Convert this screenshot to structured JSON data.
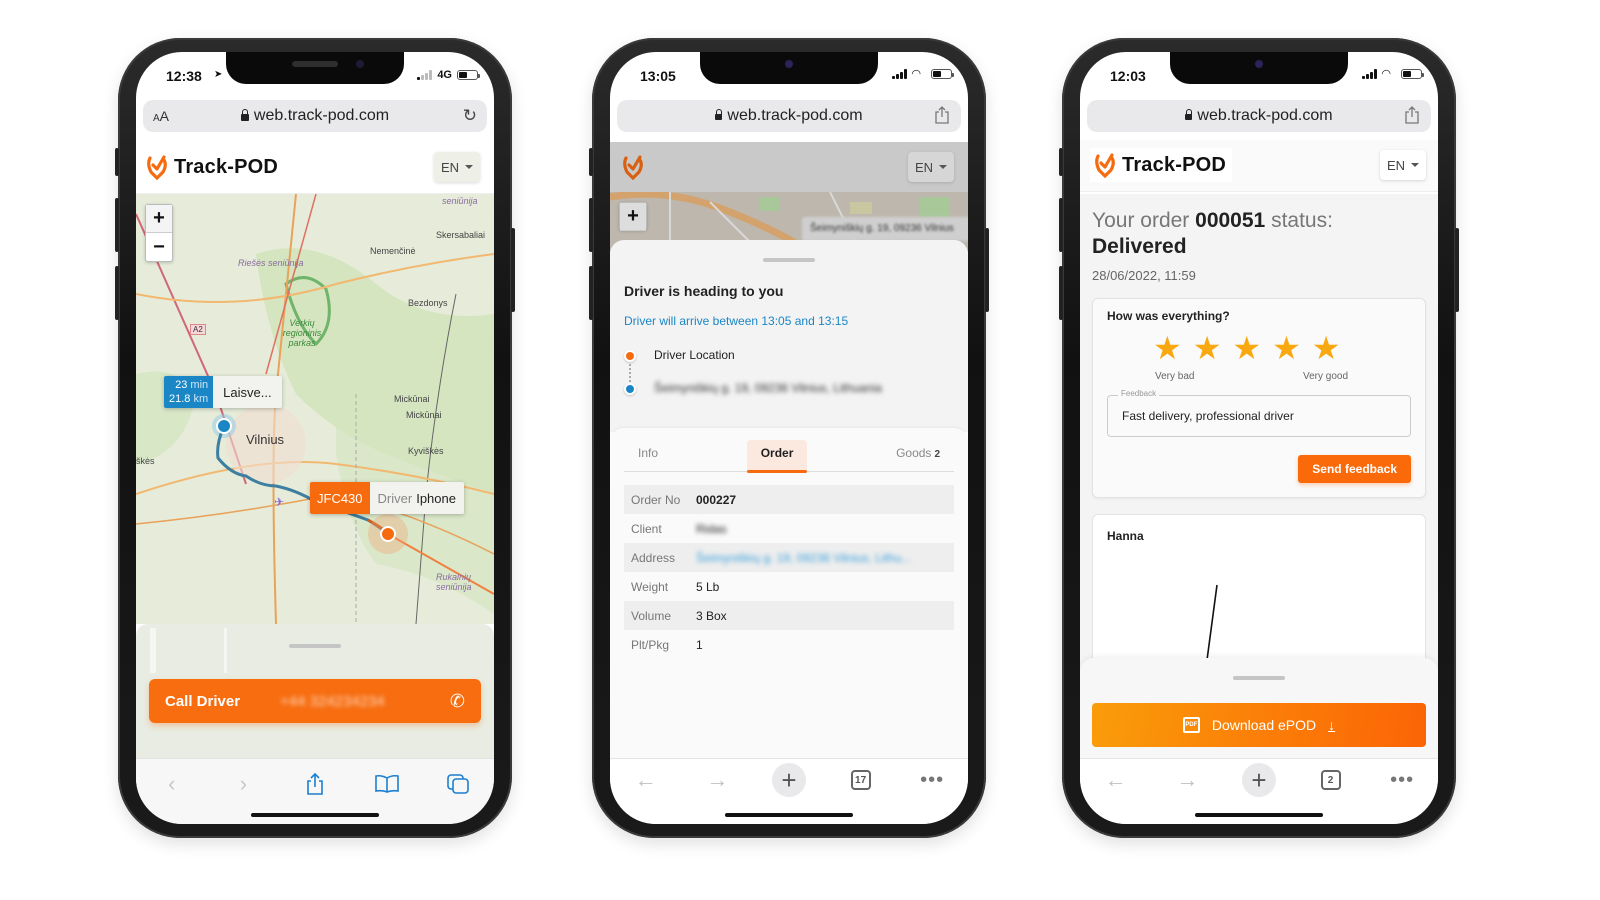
{
  "phones": [
    {
      "status": {
        "time": "12:38",
        "network": "4G",
        "location_icon": "location-arrow-icon"
      },
      "browser": {
        "text_size_label": "AA",
        "url": "web.track-pod.com",
        "reload_icon": "reload-icon"
      },
      "header": {
        "brand": "Track-POD",
        "language": "EN"
      },
      "map": {
        "zoom_in": "+",
        "zoom_out": "−",
        "labels": [
          "seniūnija",
          "Skersabaliai",
          "Nemenčinė",
          "Riešės seniūnija",
          "Bezdonys",
          "Verkių regioninis parkas",
          "Mickūnai",
          "Mickūnai",
          "Vilnius",
          "Kyviškės",
          "Rukainių seniūnija",
          "škės"
        ],
        "road_badge": "A2",
        "eta": {
          "minutes": "23",
          "minutes_unit": "min",
          "distance": "21.8",
          "distance_unit": "km"
        },
        "destination": "Laisve...",
        "vehicle": {
          "plate": "JFC430",
          "driver_prefix": "Driver",
          "driver_name": "Iphone"
        }
      },
      "call_driver": {
        "label": "Call Driver",
        "phone": "+44 324234234"
      },
      "toolbar": [
        "back",
        "forward",
        "share",
        "bookmarks",
        "tabs"
      ]
    },
    {
      "status": {
        "time": "13:05"
      },
      "browser": {
        "url": "web.track-pod.com"
      },
      "header": {
        "language": "EN"
      },
      "map": {
        "zoom_in": "+",
        "address_popup": "Šeimyniškių g. 19, 09236 Vilnius"
      },
      "sheet": {
        "title": "Driver is heading to you",
        "arrival": "Driver will arrive between 13:05 and 13:15",
        "timeline": [
          {
            "label": "Driver Location",
            "color": "#f76b0f"
          },
          {
            "label": "Šeimyniškių g. 19, 09236 Vilnius, Lithuania",
            "color": "#1a86c6"
          }
        ]
      },
      "tabs": [
        {
          "label": "Info",
          "active": false
        },
        {
          "label": "Order",
          "active": true
        },
        {
          "label": "Goods",
          "count": "2",
          "active": false
        }
      ],
      "order": [
        {
          "key": "Order No",
          "value": "000227"
        },
        {
          "key": "Client",
          "value": "Ridas"
        },
        {
          "key": "Address",
          "value": "Šeimyniškių g. 19, 09236 Vilnius, Lithu..."
        },
        {
          "key": "Weight",
          "value": "5 Lb"
        },
        {
          "key": "Volume",
          "value": "3 Box"
        },
        {
          "key": "Plt/Pkg",
          "value": "1"
        }
      ],
      "toolbar": {
        "tab_count": "17"
      }
    },
    {
      "status": {
        "time": "12:03"
      },
      "browser": {
        "url": "web.track-pod.com"
      },
      "header": {
        "brand": "Track-POD",
        "language": "EN"
      },
      "order_status": {
        "prefix": "Your order",
        "number": "000051",
        "suffix": "status:",
        "status": "Delivered",
        "date": "28/06/2022, 11:59"
      },
      "feedback": {
        "question": "How was everything?",
        "rating": 5,
        "rating_max": 5,
        "label_low": "Very bad",
        "label_high": "Very good",
        "field_label": "Feedback",
        "field_value": "Fast delivery, professional driver",
        "send_label": "Send feedback"
      },
      "signature": {
        "name": "Hanna"
      },
      "download": {
        "label": "Download ePOD",
        "pdf_badge": "PDF"
      },
      "toolbar": {
        "tab_count": "2"
      }
    }
  ],
  "colors": {
    "brand_orange": "#f76b0f",
    "link_blue": "#1a86c6",
    "star": "#f9a80f"
  }
}
